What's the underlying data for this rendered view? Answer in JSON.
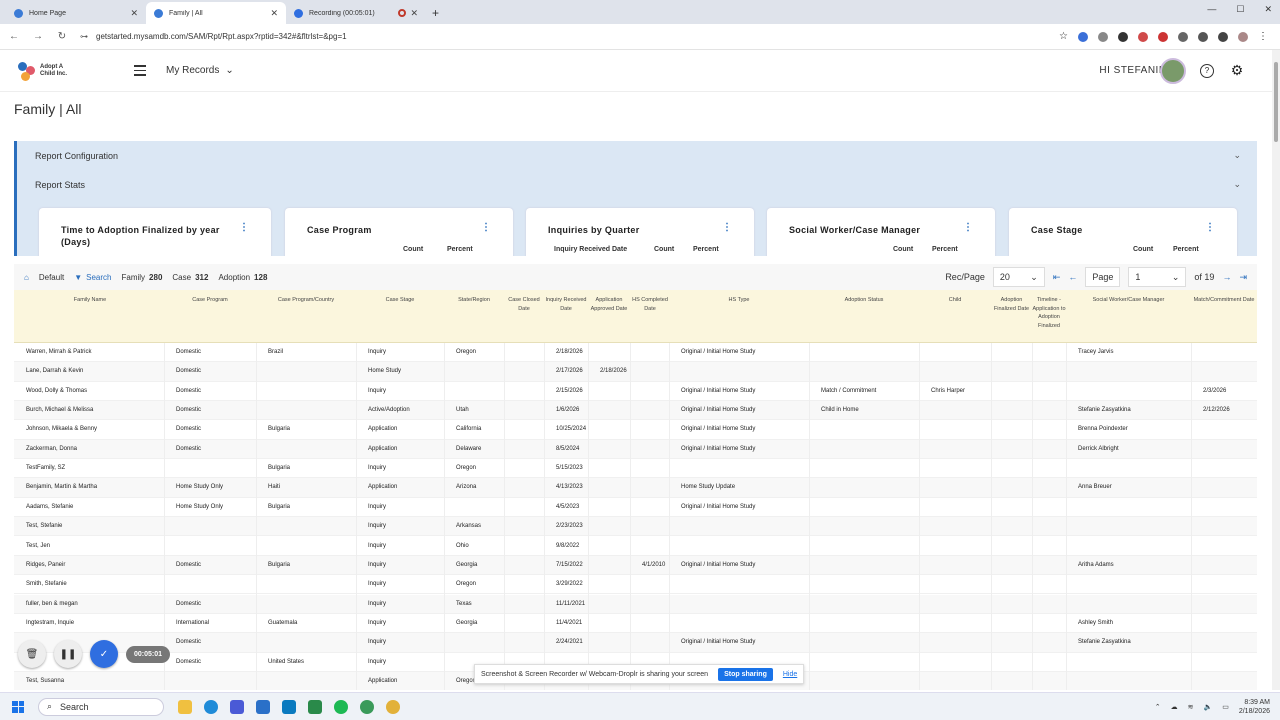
{
  "browser": {
    "tabs": [
      {
        "label": "Home Page",
        "active": false
      },
      {
        "label": "Family | All",
        "active": true
      },
      {
        "label": "Recording (00:05:01)",
        "active": false
      }
    ],
    "url": "getstarted.mysamdb.com/SAM/Rpt/Rpt.aspx?rptid=342#&fltrlst=&pg=1"
  },
  "header": {
    "logo_line1": "Adopt A",
    "logo_line2": "Child Inc.",
    "my_records": "My Records",
    "greeting": "HI STEFANIE",
    "help_icon": "?",
    "settings_icon": "⚙"
  },
  "page": {
    "title": "Family | All",
    "report_configuration": "Report Configuration",
    "report_stats": "Report Stats"
  },
  "stat_cards": [
    {
      "title": "Time to Adoption Finalized by year (Days)",
      "cols": []
    },
    {
      "title": "Case Program",
      "cols": [
        "Count",
        "Percent"
      ]
    },
    {
      "title": "Inquiries by Quarter",
      "cols": [
        "Inquiry Received Date",
        "Count",
        "Percent"
      ]
    },
    {
      "title": "Social Worker/Case Manager",
      "cols": [
        "Count",
        "Percent"
      ]
    },
    {
      "title": "Case Stage",
      "cols": [
        "Count",
        "Percent"
      ]
    }
  ],
  "toolbar": {
    "default": "Default",
    "search": "Search",
    "family_label": "Family",
    "family_count": "280",
    "case_label": "Case",
    "case_count": "312",
    "adoption_label": "Adoption",
    "adoption_count": "128",
    "rec_page_label": "Rec/Page",
    "rec_page_value": "20",
    "page_label": "Page",
    "page_value": "1",
    "of_pages": "of 19"
  },
  "table": {
    "columns": [
      "Family Name",
      "Case Program",
      "Case Program/Country",
      "Case Stage",
      "State/Region",
      "Case Closed Date",
      "Inquiry Received Date",
      "Application Approved Date",
      "HS Completed Date",
      "HS Type",
      "Adoption Status",
      "Child",
      "Adoption Finalized Date",
      "Timeline - Application to Adoption Finalized",
      "Social Worker/Case Manager",
      "Match/Commitment Date"
    ],
    "rows": [
      [
        "Warren, Mirrah & Patrick",
        "Domestic",
        "Brazil",
        "Inquiry",
        "Oregon",
        "",
        "2/18/2026",
        "",
        "",
        "Original / Initial Home Study",
        "",
        "",
        "",
        "",
        "Tracey Jarvis",
        ""
      ],
      [
        "Lane, Darrah & Kevin",
        "Domestic",
        "",
        "Home Study",
        "",
        "",
        "2/17/2026",
        "2/18/2026",
        "",
        "",
        "",
        "",
        "",
        "",
        "",
        ""
      ],
      [
        "Wood, Dolly & Thomas",
        "Domestic",
        "",
        "Inquiry",
        "",
        "",
        "2/15/2026",
        "",
        "",
        "Original / Initial Home Study",
        "Match / Commitment",
        "Chris Harper",
        "",
        "",
        "",
        "2/3/2026"
      ],
      [
        "Burch, Michael & Melissa",
        "Domestic",
        "",
        "Active/Adoption",
        "Utah",
        "",
        "1/6/2026",
        "",
        "",
        "Original / Initial Home Study",
        "Child in Home",
        "",
        "",
        "",
        "Stefanie Zasyatkina",
        "2/12/2026"
      ],
      [
        "Johnson, Mikaela & Benny",
        "Domestic",
        "Bulgaria",
        "Application",
        "California",
        "",
        "10/25/2024",
        "",
        "",
        "Original / Initial Home Study",
        "",
        "",
        "",
        "",
        "Brenna Poindexter",
        ""
      ],
      [
        "Zackerman, Donna",
        "Domestic",
        "",
        "Application",
        "Delaware",
        "",
        "8/5/2024",
        "",
        "",
        "Original / Initial Home Study",
        "",
        "",
        "",
        "",
        "Derrick Albright",
        ""
      ],
      [
        "TestFamily, SZ",
        "",
        "Bulgaria",
        "Inquiry",
        "Oregon",
        "",
        "5/15/2023",
        "",
        "",
        "",
        "",
        "",
        "",
        "",
        "",
        ""
      ],
      [
        "Benjamin, Martin & Martha",
        "Home Study Only",
        "Haiti",
        "Application",
        "Arizona",
        "",
        "4/13/2023",
        "",
        "",
        "Home Study Update",
        "",
        "",
        "",
        "",
        "Anna Breuer",
        ""
      ],
      [
        "Aadams, Stefanie",
        "Home Study Only",
        "Bulgaria",
        "Inquiry",
        "",
        "",
        "4/5/2023",
        "",
        "",
        "Original / Initial Home Study",
        "",
        "",
        "",
        "",
        "",
        ""
      ],
      [
        "Test, Stefanie",
        "",
        "",
        "Inquiry",
        "Arkansas",
        "",
        "2/23/2023",
        "",
        "",
        "",
        "",
        "",
        "",
        "",
        "",
        ""
      ],
      [
        "Test, Jen",
        "",
        "",
        "Inquiry",
        "Ohio",
        "",
        "9/8/2022",
        "",
        "",
        "",
        "",
        "",
        "",
        "",
        "",
        ""
      ],
      [
        "Ridges, Paneir",
        "Domestic",
        "Bulgaria",
        "Inquiry",
        "Georgia",
        "",
        "7/15/2022",
        "",
        "4/1/2010",
        "Original / Initial Home Study",
        "",
        "",
        "",
        "",
        "Aritha Adams",
        ""
      ],
      [
        "Smith, Stefanie",
        "",
        "",
        "Inquiry",
        "Oregon",
        "",
        "3/29/2022",
        "",
        "",
        "",
        "",
        "",
        "",
        "",
        "",
        ""
      ],
      [
        "fuller, ben & megan",
        "Domestic",
        "",
        "Inquiry",
        "Texas",
        "",
        "11/11/2021",
        "",
        "",
        "",
        "",
        "",
        "",
        "",
        "",
        ""
      ],
      [
        "Ingtestram, Inquie",
        "International",
        "Guatemala",
        "Inquiry",
        "Georgia",
        "",
        "11/4/2021",
        "",
        "",
        "",
        "",
        "",
        "",
        "",
        "Ashley Smith",
        ""
      ],
      [
        "",
        "Domestic",
        "",
        "Inquiry",
        "",
        "",
        "2/24/2021",
        "",
        "",
        "Original / Initial Home Study",
        "",
        "",
        "",
        "",
        "Stefanie Zasyatkina",
        ""
      ],
      [
        "",
        "Domestic",
        "United States",
        "Inquiry",
        "",
        "",
        "",
        "",
        "",
        "",
        "",
        "",
        "",
        "",
        "",
        ""
      ],
      [
        "Test, Susanna",
        "",
        "",
        "Application",
        "Oregon",
        "",
        "",
        "",
        "",
        "",
        "",
        "",
        "",
        "",
        "",
        ""
      ]
    ]
  },
  "recorder": {
    "time": "00:05:01",
    "share_text": "Screenshot & Screen Recorder w/ Webcam-Droplr is sharing your screen",
    "stop_label": "Stop sharing",
    "hide_label": "Hide"
  },
  "taskbar": {
    "search": "Search",
    "time": "8:39 AM",
    "date": "2/18/2026"
  }
}
